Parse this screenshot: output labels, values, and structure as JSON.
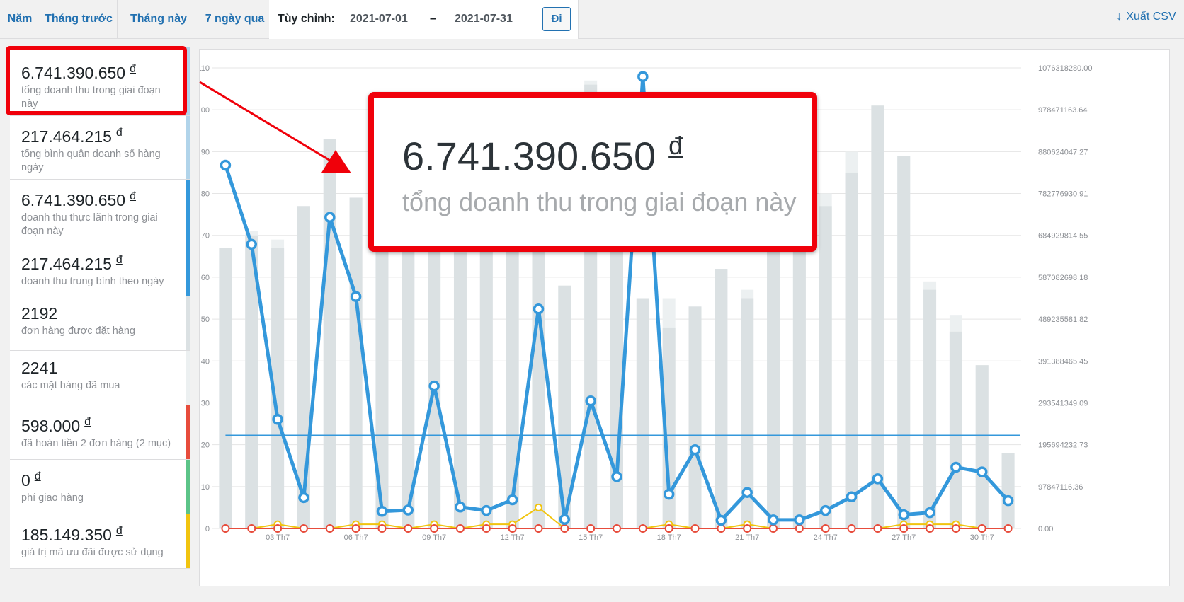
{
  "range_tabs": [
    {
      "label": "Năm"
    },
    {
      "label": "Tháng trước"
    },
    {
      "label": "Tháng này"
    },
    {
      "label": "7 ngày qua"
    }
  ],
  "custom_range": {
    "label": "Tùy chỉnh:",
    "from": "2021-07-01",
    "separator": "–",
    "to": "2021-07-31",
    "go_label": "Đi"
  },
  "export_label": "Xuất CSV",
  "currency": "đ",
  "legend": [
    {
      "value": "6.741.390.650",
      "currency": true,
      "desc": "tổng doanh thu trong giai đoạn này",
      "color": "#b1d4ea"
    },
    {
      "value": "217.464.215",
      "currency": true,
      "desc": "tổng bình quân doanh số hàng ngày",
      "color": "#b1d4ea"
    },
    {
      "value": "6.741.390.650",
      "currency": true,
      "desc": "doanh thu thực lãnh trong giai đoạn này",
      "color": "#3498db"
    },
    {
      "value": "217.464.215",
      "currency": true,
      "desc": "doanh thu trung bình theo ngày",
      "color": "#3498db"
    },
    {
      "value": "2192",
      "currency": false,
      "desc": "đơn hàng được đặt hàng",
      "color": "#dbe1e3"
    },
    {
      "value": "2241",
      "currency": false,
      "desc": "các mặt hàng đã mua",
      "color": "#ecf0f1"
    },
    {
      "value": "598.000",
      "currency": true,
      "desc": "đã hoàn tiền 2 đơn hàng (2 mục)",
      "color": "#e74c3c"
    },
    {
      "value": "0",
      "currency": true,
      "desc": "phí giao hàng",
      "color": "#5cc488"
    },
    {
      "value": "185.149.350",
      "currency": true,
      "desc": "giá trị mã ưu đãi được sử dụng",
      "color": "#f1c40f"
    }
  ],
  "zoom_callout": {
    "value": "6.741.390.650",
    "desc": "tổng doanh thu trong giai đoạn này"
  },
  "chart_data": {
    "type": "bar",
    "left_axis_ticks": [
      "0",
      "10",
      "20",
      "30",
      "40",
      "50",
      "60",
      "70",
      "80",
      "90",
      "100",
      "110"
    ],
    "ylim_left": [
      0,
      110
    ],
    "right_axis_ticks": [
      "0.00",
      "97847116.36",
      "195694232.73",
      "293541349.09",
      "391388465.45",
      "489235581.82",
      "587082698.18",
      "684929814.55",
      "782776930.91",
      "880624047.27",
      "978471163.64",
      "1076318280.00"
    ],
    "ylim_right": [
      0,
      1076318280
    ],
    "x_tick_labels": [
      "03 Th7",
      "06 Th7",
      "09 Th7",
      "12 Th7",
      "15 Th7",
      "18 Th7",
      "21 Th7",
      "24 Th7",
      "27 Th7",
      "30 Th7"
    ],
    "x_tick_days": [
      3,
      6,
      9,
      12,
      15,
      18,
      21,
      24,
      27,
      30
    ],
    "days": [
      1,
      2,
      3,
      4,
      5,
      6,
      7,
      8,
      9,
      10,
      11,
      12,
      13,
      14,
      15,
      16,
      17,
      18,
      19,
      20,
      21,
      22,
      23,
      24,
      25,
      26,
      27,
      28,
      29,
      30,
      31
    ],
    "series": [
      {
        "values": [
          67,
          70,
          67,
          77,
          93,
          79,
          90,
          85,
          84,
          66,
          76,
          71,
          87,
          58,
          106,
          79,
          55,
          48,
          53,
          62,
          55,
          68,
          67,
          77,
          85,
          101,
          89,
          57,
          47,
          39,
          18
        ],
        "color": "#dbe1e3"
      },
      {
        "values": [
          67,
          71,
          69,
          77,
          93,
          79,
          90,
          85,
          84,
          66,
          76,
          72,
          87,
          58,
          107,
          79,
          55,
          55,
          53,
          62,
          57,
          68,
          67,
          80,
          90,
          101,
          89,
          59,
          51,
          39,
          18
        ],
        "color": "#ecf0f1"
      },
      {
        "values": [
          849000000,
          664000000,
          255000000,
          72000000,
          727000000,
          542000000,
          40000000,
          43000000,
          333000000,
          50000000,
          42000000,
          67000000,
          513000000,
          21000000,
          298000000,
          121000000,
          1056000000,
          80000000,
          184000000,
          19000000,
          84000000,
          20000000,
          20000000,
          42000000,
          74000000,
          116000000,
          32000000,
          37000000,
          143000000,
          132000000,
          65000000
        ],
        "color": "#3498db"
      },
      {
        "values": [
          217464215
        ],
        "color": "#3498db"
      },
      {
        "values": [
          0,
          0,
          1,
          0,
          0,
          1,
          1,
          0,
          1,
          0,
          1,
          1,
          5,
          0,
          0,
          0,
          0,
          1,
          0,
          0,
          1,
          0,
          0,
          0,
          0,
          0,
          1,
          1,
          1,
          0,
          0
        ],
        "color": "#f1c40f"
      },
      {
        "values": [
          0,
          0,
          0,
          0,
          0,
          0,
          0,
          0,
          0,
          0,
          0,
          0,
          0,
          0,
          0,
          0,
          0,
          0,
          0,
          0,
          0,
          0,
          0,
          0,
          0,
          0,
          0,
          0,
          0,
          0,
          0
        ],
        "color": "#e74c3c"
      }
    ],
    "grid": true
  }
}
